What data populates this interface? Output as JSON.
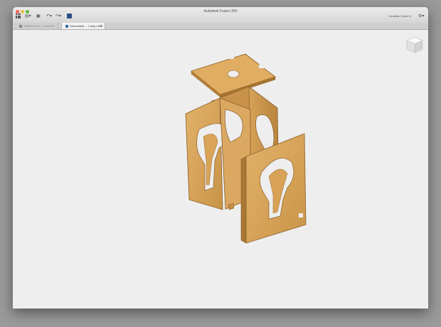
{
  "window": {
    "title": "Autodesk Fusion 360"
  },
  "toolbar": {
    "user_name": "Jonathan Odom ▾",
    "icons": [
      "grid-icon",
      "file-icon",
      "save-icon",
      "undo-icon",
      "redo-icon",
      "data-panel-icon",
      "help-icon"
    ]
  },
  "tabs": [
    {
      "label": "Williams Sail... Lamp BU v5"
    },
    {
      "label": "Instructable ... Lamp LED*"
    }
  ],
  "viewport": {
    "content": "exploded 3D model of wooden lamp box"
  },
  "colors": {
    "wood": "#d9a65a",
    "wood_dark": "#b98440",
    "canvas": "#eeeeee"
  }
}
